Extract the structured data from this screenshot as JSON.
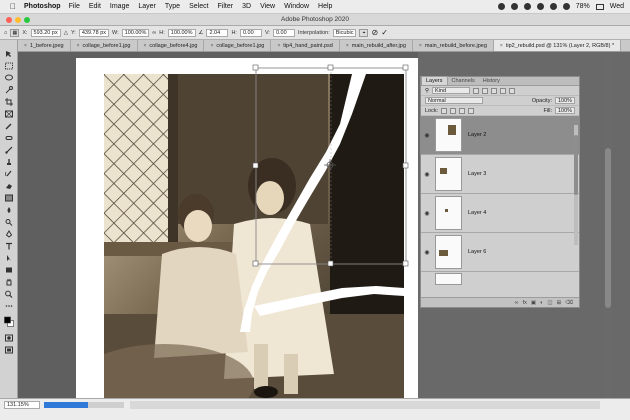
{
  "menubar": {
    "app_name": "Photoshop",
    "items": [
      "File",
      "Edit",
      "Image",
      "Layer",
      "Type",
      "Select",
      "Filter",
      "3D",
      "View",
      "Window",
      "Help"
    ],
    "battery": "78%",
    "day": "Wed"
  },
  "titlebar": {
    "title": "Adobe Photoshop 2020"
  },
  "options": {
    "x_label": "X:",
    "x_value": "593.20 px",
    "y_label": "Y:",
    "y_value": "439.78 px",
    "w_label": "W:",
    "w_value": "100.00%",
    "h_label": "H:",
    "h_value": "100.00%",
    "angle_value": "2.04",
    "hskew_label": "H:",
    "hskew_value": "0.00",
    "vskew_label": "V:",
    "vskew_value": "0.00",
    "interp_label": "Interpolation:",
    "interp_value": "Bicubic"
  },
  "tabs": [
    {
      "label": "1_before.jpeg",
      "active": false
    },
    {
      "label": "collage_before1.jpg",
      "active": false
    },
    {
      "label": "collage_before4.jpg",
      "active": false
    },
    {
      "label": "collage_before1.jpg",
      "active": false
    },
    {
      "label": "tip4_hand_paint.psd",
      "active": false
    },
    {
      "label": "main_rebuild_after.jpg",
      "active": false
    },
    {
      "label": "main_rebuild_before.jpeg",
      "active": false
    },
    {
      "label": "tip2_rebuild.psd @ 131% (Layer 2, RGB/8) *",
      "active": true
    }
  ],
  "layers_panel": {
    "tabs": [
      "Layers",
      "Channels",
      "History"
    ],
    "kind_label": "Kind",
    "blend_mode": "Normal",
    "opacity_label": "Opacity:",
    "opacity_value": "100%",
    "lock_label": "Lock:",
    "fill_label": "Fill:",
    "fill_value": "100%",
    "layers": [
      {
        "name": "Layer 2",
        "selected": true
      },
      {
        "name": "Layer 3",
        "selected": false
      },
      {
        "name": "Layer 4",
        "selected": false
      },
      {
        "name": "Layer 6",
        "selected": false
      }
    ]
  },
  "status": {
    "zoom": "131.15%",
    "progress_fraction": 0.55
  },
  "colors": {
    "accent": "#2f7ad8",
    "selected_layer": "#8d8d8d",
    "canvas_bg": "#5f5f5f"
  }
}
